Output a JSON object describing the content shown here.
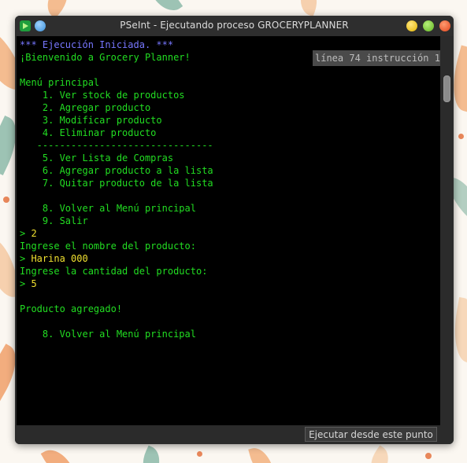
{
  "window": {
    "title": "PSeInt - Ejecutando proceso GROCERYPLANNER"
  },
  "status": {
    "text": "línea 74 instrucción 1"
  },
  "console": {
    "lines": [
      {
        "text": "*** Ejecución Iniciada. ***",
        "color": "blue"
      },
      {
        "text": "¡Bienvenido a Grocery Planner!",
        "color": "green"
      },
      {
        "text": "",
        "color": "green"
      },
      {
        "text": "Menú principal",
        "color": "green"
      },
      {
        "text": "    1. Ver stock de productos",
        "color": "green"
      },
      {
        "text": "    2. Agregar producto",
        "color": "green"
      },
      {
        "text": "    3. Modificar producto",
        "color": "green"
      },
      {
        "text": "    4. Eliminar producto",
        "color": "green"
      },
      {
        "text": "   -------------------------------",
        "color": "green"
      },
      {
        "text": "    5. Ver Lista de Compras",
        "color": "green"
      },
      {
        "text": "    6. Agregar producto a la lista",
        "color": "green"
      },
      {
        "text": "    7. Quitar producto de la lista",
        "color": "green"
      },
      {
        "text": "",
        "color": "green"
      },
      {
        "text": "    8. Volver al Menú principal",
        "color": "green"
      },
      {
        "text": "    9. Salir",
        "color": "green"
      },
      {
        "text": "> ",
        "input": "2",
        "color": "green"
      },
      {
        "text": "Ingrese el nombre del producto:",
        "color": "green"
      },
      {
        "text": "> ",
        "input": "Harina 000",
        "color": "green"
      },
      {
        "text": "Ingrese la cantidad del producto:",
        "color": "green"
      },
      {
        "text": "> ",
        "input": "5",
        "color": "green"
      },
      {
        "text": "",
        "color": "green"
      },
      {
        "text": "Producto agregado!",
        "color": "green"
      },
      {
        "text": "",
        "color": "green"
      },
      {
        "text": "    8. Volver al Menú principal",
        "color": "green"
      }
    ]
  },
  "bottom": {
    "run_button_label": "Ejecutar desde este punto"
  },
  "colors": {
    "blue": "#7777ff",
    "green": "#22dd22",
    "yellow": "#f0e030"
  },
  "icons": {
    "app": "pseint-app-icon",
    "pin": "pin-icon",
    "minimize": "minimize-icon",
    "maximize": "maximize-icon",
    "close": "close-icon"
  }
}
